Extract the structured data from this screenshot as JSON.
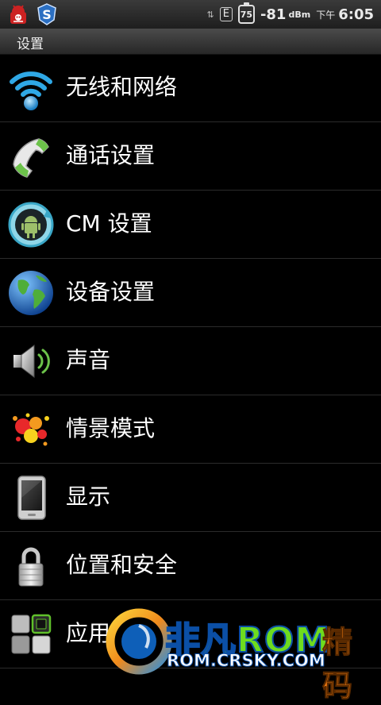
{
  "status_bar": {
    "network_type": "E",
    "battery_level": "75",
    "signal_value": "-81",
    "signal_unit": "dBm",
    "ampm": "下午",
    "time": "6:05"
  },
  "header": {
    "title": "设置"
  },
  "settings": {
    "items": [
      {
        "label": "无线和网络",
        "icon": "wifi-icon"
      },
      {
        "label": "通话设置",
        "icon": "phone-handset-icon"
      },
      {
        "label": "CM 设置",
        "icon": "cyanogenmod-icon"
      },
      {
        "label": "设备设置",
        "icon": "globe-icon"
      },
      {
        "label": "声音",
        "icon": "speaker-icon"
      },
      {
        "label": "情景模式",
        "icon": "paint-splash-icon"
      },
      {
        "label": "显示",
        "icon": "phone-screen-icon"
      },
      {
        "label": "位置和安全",
        "icon": "padlock-icon"
      },
      {
        "label": "应用",
        "icon": "applications-grid-icon"
      }
    ]
  },
  "watermark": {
    "brand": "非凡ROM",
    "url": "ROM.CRSKY.COM",
    "extra": "精码"
  },
  "colors": {
    "background": "#000000",
    "divider": "#2b2b2b",
    "wifi_blue": "#2fa8e6",
    "phone_green": "#6cc24a",
    "watermark_green": "#6edc1e"
  }
}
